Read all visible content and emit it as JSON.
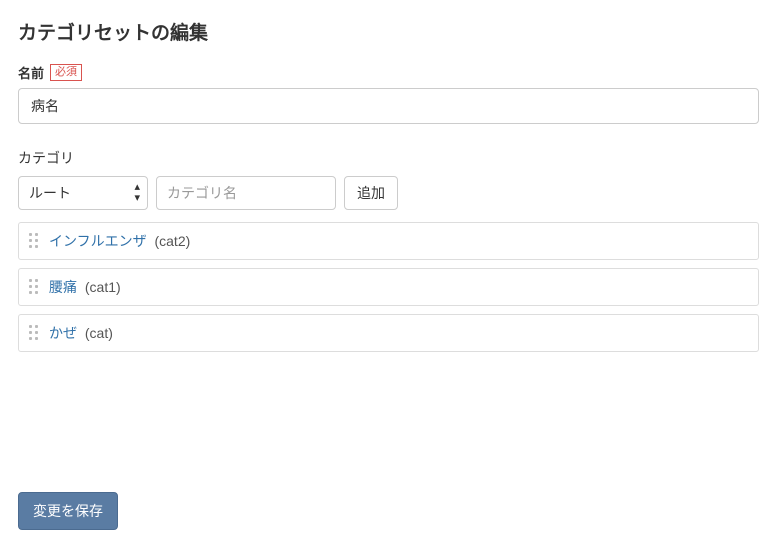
{
  "pageTitle": "カテゴリセットの編集",
  "name": {
    "label": "名前",
    "requiredBadge": "必須",
    "value": "病名"
  },
  "categorySection": {
    "label": "カテゴリ",
    "selectOption": "ルート",
    "newCategoryPlaceholder": "カテゴリ名",
    "addButton": "追加"
  },
  "categories": [
    {
      "name": "インフルエンザ",
      "code": "(cat2)"
    },
    {
      "name": "腰痛",
      "code": "(cat1)"
    },
    {
      "name": "かぜ",
      "code": "(cat)"
    }
  ],
  "saveButton": "変更を保存"
}
